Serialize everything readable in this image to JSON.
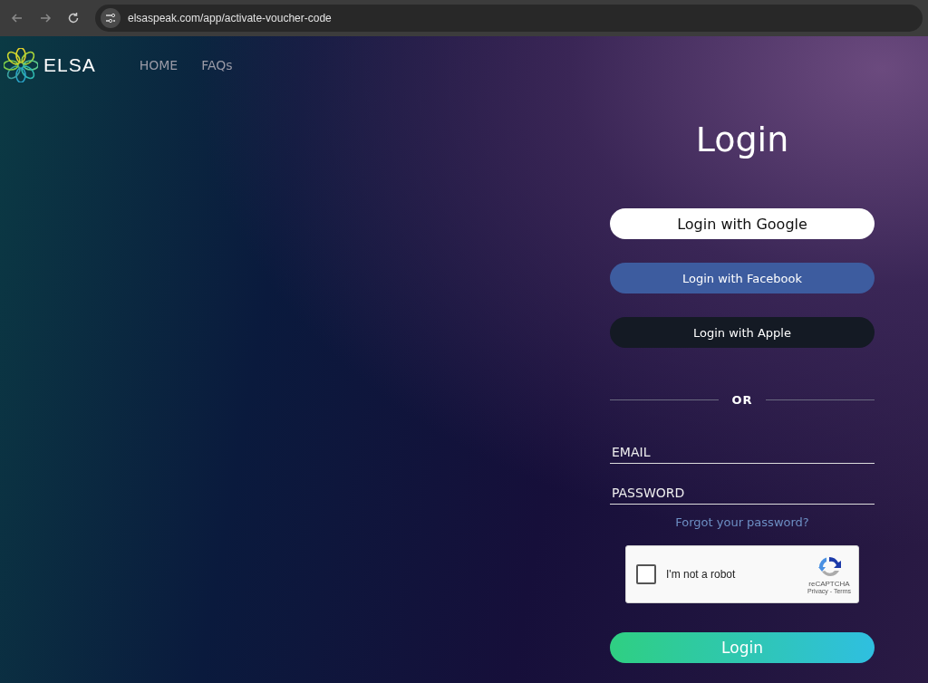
{
  "browser": {
    "url": "elsaspeak.com/app/activate-voucher-code"
  },
  "nav": {
    "logo_text": "ELSA",
    "links": [
      "HOME",
      "FAQs"
    ]
  },
  "login": {
    "title": "Login",
    "social_buttons": [
      {
        "label": "Login with Google",
        "kind": "google"
      },
      {
        "label": "Login with Facebook",
        "kind": "facebook"
      },
      {
        "label": "Login with Apple",
        "kind": "apple"
      }
    ],
    "divider": "OR",
    "fields": [
      {
        "placeholder": "EMAIL"
      },
      {
        "placeholder": "PASSWORD"
      }
    ],
    "forgot_link": "Forgot your password?",
    "captcha": {
      "label": "I'm not a robot",
      "checked": false,
      "brand": "reCAPTCHA",
      "links": "Privacy - Terms"
    },
    "submit": "Login"
  }
}
